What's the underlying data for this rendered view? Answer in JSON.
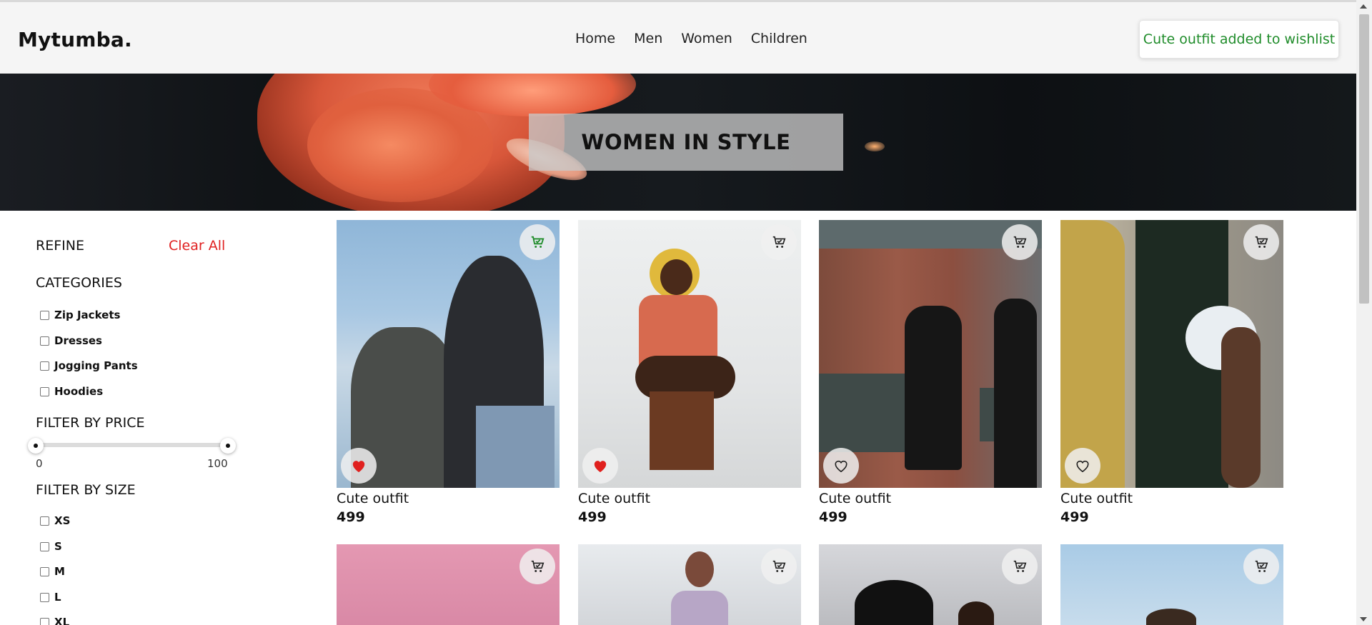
{
  "header": {
    "logo": "Mytumba.",
    "nav": [
      "Home",
      "Men",
      "Women",
      "Children"
    ],
    "toast": "Cute outfit added to wishlist"
  },
  "hero": {
    "title": "WOMEN IN STYLE"
  },
  "sidebar": {
    "refine": "REFINE",
    "clear_all": "Clear All",
    "categories_title": "CATEGORIES",
    "categories": [
      "Zip Jackets",
      "Dresses",
      "Jogging Pants",
      "Hoodies"
    ],
    "price_title": "FILTER BY PRICE",
    "price_min": "0",
    "price_max": "100",
    "price_range": [
      0,
      100
    ],
    "size_title": "FILTER BY SIZE",
    "sizes": [
      "XS",
      "S",
      "M",
      "L",
      "XL"
    ]
  },
  "products": [
    {
      "name": "Cute outfit",
      "price": "499",
      "in_cart": true,
      "wishlisted": true
    },
    {
      "name": "Cute outfit",
      "price": "499",
      "in_cart": false,
      "wishlisted": true
    },
    {
      "name": "Cute outfit",
      "price": "499",
      "in_cart": false,
      "wishlisted": false
    },
    {
      "name": "Cute outfit",
      "price": "499",
      "in_cart": false,
      "wishlisted": false
    }
  ],
  "colors": {
    "accent_green": "#1f8c2a",
    "clear_red": "#e02020",
    "heart_red": "#e0201e"
  }
}
